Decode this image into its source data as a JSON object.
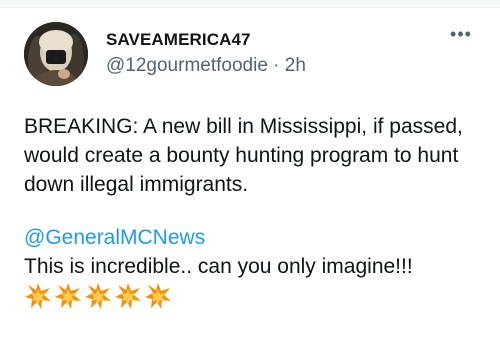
{
  "tweet": {
    "author": {
      "display_name": "SAVEAMERICA47",
      "handle": "@12gourmetfoodie",
      "separator": "·",
      "time": "2h"
    },
    "more_icon": "more-horizontal-icon",
    "text": {
      "headline": "BREAKING: A new bill in Mississippi, if passed, would create a bounty hunting program to hunt down illegal immigrants.",
      "mention": "@GeneralMCNews",
      "comment": "This is incredible.. can you only imagine!!!"
    },
    "emojis": [
      "collision-emoji",
      "collision-emoji",
      "collision-emoji",
      "collision-emoji",
      "collision-emoji"
    ],
    "colors": {
      "text": "#0f1419",
      "secondary": "#536471",
      "link": "#1d9bf0"
    }
  }
}
